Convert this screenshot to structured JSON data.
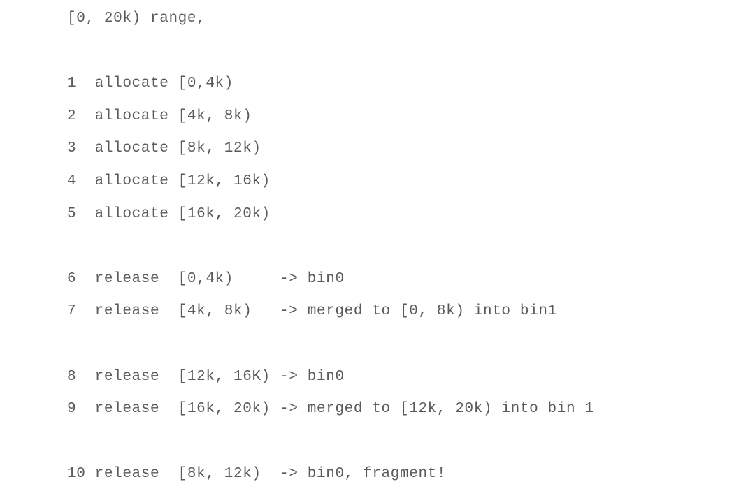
{
  "document": {
    "kind": "plain-text-listing",
    "background_color": "#ffffff",
    "text_color": "#5a5a5a",
    "header": "[0, 20k) range,",
    "lines": [
      {
        "id": "header",
        "text": "[0, 20k) range,"
      },
      {
        "id": "blank-1",
        "text": ""
      },
      {
        "id": "step-1",
        "text": "1  allocate [0,4k)"
      },
      {
        "id": "step-2",
        "text": "2  allocate [4k, 8k)"
      },
      {
        "id": "step-3",
        "text": "3  allocate [8k, 12k)"
      },
      {
        "id": "step-4",
        "text": "4  allocate [12k, 16k)"
      },
      {
        "id": "step-5",
        "text": "5  allocate [16k, 20k)"
      },
      {
        "id": "blank-2",
        "text": ""
      },
      {
        "id": "step-6",
        "text": "6  release  [0,4k)     -> bin0"
      },
      {
        "id": "step-7",
        "text": "7  release  [4k, 8k)   -> merged to [0, 8k) into bin1"
      },
      {
        "id": "blank-3",
        "text": ""
      },
      {
        "id": "step-8",
        "text": "8  release  [12k, 16K) -> bin0"
      },
      {
        "id": "step-9",
        "text": "9  release  [16k, 20k) -> merged to [12k, 20k) into bin 1"
      },
      {
        "id": "blank-4",
        "text": ""
      },
      {
        "id": "step-10",
        "text": "10 release  [8k, 12k)  -> bin0, fragment!"
      }
    ],
    "steps": [
      {
        "number": "1",
        "operation": "allocate",
        "range": "[0,4k)",
        "arrow": "",
        "result": ""
      },
      {
        "number": "2",
        "operation": "allocate",
        "range": "[4k, 8k)",
        "arrow": "",
        "result": ""
      },
      {
        "number": "3",
        "operation": "allocate",
        "range": "[8k, 12k)",
        "arrow": "",
        "result": ""
      },
      {
        "number": "4",
        "operation": "allocate",
        "range": "[12k, 16k)",
        "arrow": "",
        "result": ""
      },
      {
        "number": "5",
        "operation": "allocate",
        "range": "[16k, 20k)",
        "arrow": "",
        "result": ""
      },
      {
        "number": "6",
        "operation": "release",
        "range": "[0,4k)",
        "arrow": "->",
        "result": "bin0"
      },
      {
        "number": "7",
        "operation": "release",
        "range": "[4k, 8k)",
        "arrow": "->",
        "result": "merged to [0, 8k) into bin1"
      },
      {
        "number": "8",
        "operation": "release",
        "range": "[12k, 16K)",
        "arrow": "->",
        "result": "bin0"
      },
      {
        "number": "9",
        "operation": "release",
        "range": "[16k, 20k)",
        "arrow": "->",
        "result": "merged to [12k, 20k) into bin 1"
      },
      {
        "number": "10",
        "operation": "release",
        "range": "[8k, 12k)",
        "arrow": "->",
        "result": "bin0, fragment!"
      }
    ]
  }
}
